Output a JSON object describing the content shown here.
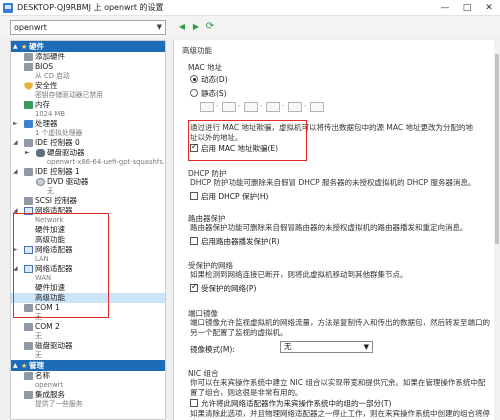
{
  "window": {
    "title": "DESKTOP-QJ9RBMJ 上 openwrt 的设置"
  },
  "toolbar": {
    "vm_name": "openwrt"
  },
  "tree": {
    "hardware": "硬件",
    "add_hardware": "添加硬件",
    "bios": "BIOS",
    "bios_sub": "从 CD 启动",
    "security": "安全性",
    "security_sub": "密钥存储驱动器已禁用",
    "memory": "内存",
    "memory_sub": "1024 MB",
    "processor": "处理器",
    "processor_sub": "1 个虚拟处理器",
    "ide0": "IDE 控制器 0",
    "hdd": "硬盘驱动器",
    "hdd_sub": "openwrt-x86-64-uefi-gpt-squashfs...",
    "ide1": "IDE 控制器 1",
    "dvd": "DVD 驱动器",
    "dvd_sub": "无",
    "scsi": "SCSI 控制器",
    "nic1": "网络适配器",
    "nic1_sub": "Network",
    "hw_accel1": "硬件加速",
    "adv1": "高级功能",
    "nic2": "网络适配器",
    "nic2_sub": "LAN",
    "nic3": "网络适配器",
    "nic3_sub": "WAN",
    "hw_accel3": "硬件加速",
    "adv3": "高级功能",
    "com1": "COM 1",
    "com1_sub": "无",
    "com2": "COM 2",
    "com2_sub": "无",
    "floppy": "磁盘驱动器",
    "floppy_sub": "无",
    "management": "管理",
    "name": "名称",
    "name_sub": "openwrt",
    "integration": "集成服务",
    "integration_sub": "提供了一些服务"
  },
  "panel": {
    "header": "高级功能",
    "mac_section": "MAC 地址",
    "dynamic": "动态(D)",
    "static": "静态(S)",
    "spoof_desc": "通过进行 MAC 地址欺骗，虚拟机可以将传出数据包中的源 MAC 地址更改为分配的地址以外的地址。",
    "spoof_label": "启用 MAC 地址欺骗(E)",
    "dhcp_section": "DHCP 防护",
    "dhcp_desc": "DHCP 防护功能可删除来自假冒 DHCP 服务器的未授权虚拟机的 DHCP 服务器消息。",
    "dhcp_label": "启用 DHCP 保护(H)",
    "router_section": "路由器保护",
    "router_desc": "路由器保护功能可删除来自假冒路由器的未授权虚拟机的路由器播发和重定向消息。",
    "router_label": "启用路由器播发保护(R)",
    "protected_section": "受保护的网络",
    "protected_desc": "如果检测到网络连接已断开，则将此虚拟机移动到其他群集节点。",
    "protected_label": "受保护的网络(P)",
    "mirror_section": "端口镜像",
    "mirror_desc": "端口镜像允许监视虚拟机的网络流量，方法是复制传入和传出的数据包，然后转发至端口的另一个配置了监视的虚拟机。",
    "mirror_mode_label": "镜像模式(M):",
    "mirror_mode_value": "无",
    "nic_team_section": "NIC 组合",
    "nic_team_desc": "你可以在来宾操作系统中建立 NIC 组合以实现带宽和提供冗余。如果在管理操作系统中配置了组合，则这很是非常有用的。",
    "nic_team_label": "允许将此网络适配器作为来宾操作系统中的组的一部分(T)",
    "nic_team_desc2": "如果清除此选项，并且物理网络适配器之一停止工作，则在来宾操作系统中创建的组合将停止"
  },
  "colors": {
    "category": "#1e6bb8",
    "highlight": "#e02b2b",
    "selection": "#cce4f7"
  }
}
